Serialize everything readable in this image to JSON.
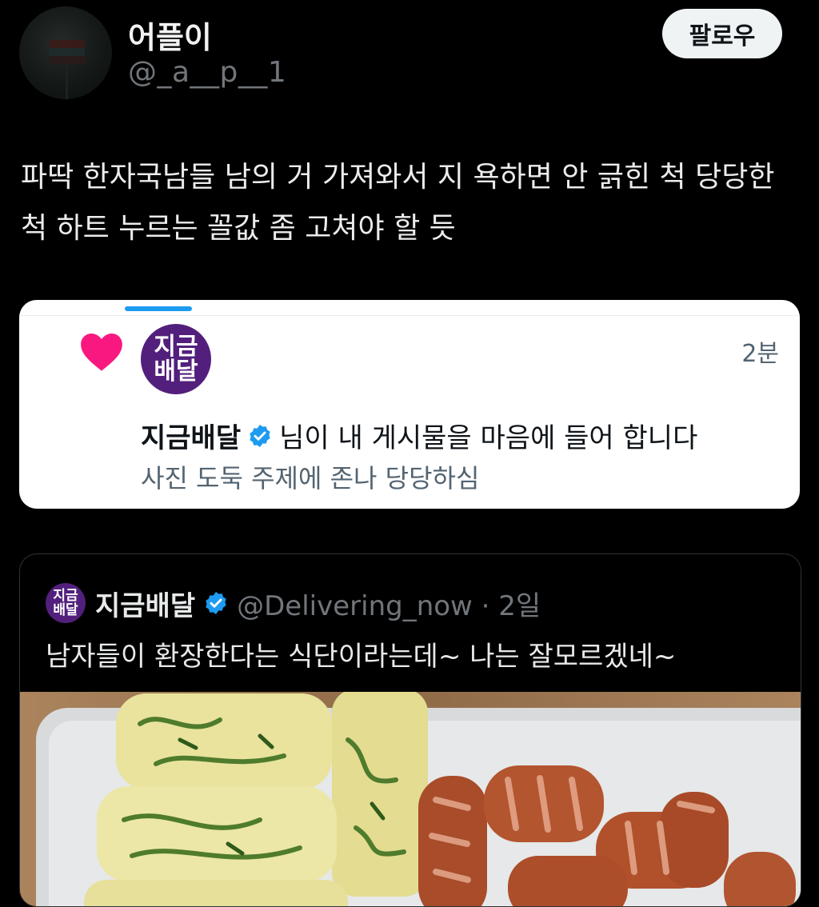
{
  "author": {
    "display_name": "어플이",
    "handle": "@_a__p__1",
    "avatar_icon": "avatar-road-sign"
  },
  "follow_button": {
    "label": "팔로우"
  },
  "tweet": {
    "text": "파딱 한자국남들 남의 거 가져와서 지 욕하면 안 긁힌 척 당당한 척 하트 누르는 꼴값 좀 고쳐야 할 듯"
  },
  "notification": {
    "icon": "heart-icon",
    "avatar_line1": "지금",
    "avatar_line2": "배달",
    "time": "2분",
    "user_name": "지금배달",
    "action_text": "님이 내 게시물을 마음에 들어 합니다",
    "subtext": "사진 도둑 주제에 존나 당당하심",
    "colors": {
      "heart": "#f91880",
      "avatar_bg": "#52207c",
      "verified": "#1d9bf0",
      "tab_indicator": "#1d9bf0"
    }
  },
  "quoted_tweet": {
    "avatar_line1": "지금",
    "avatar_line2": "배달",
    "name": "지금배달",
    "handle_time": "@Delivering_now · 2일",
    "text": "남자들이 환장한다는 식단이라는데~ 나는 잘모르겠네~",
    "media_icon": "food-photo-omelette-sausage"
  }
}
